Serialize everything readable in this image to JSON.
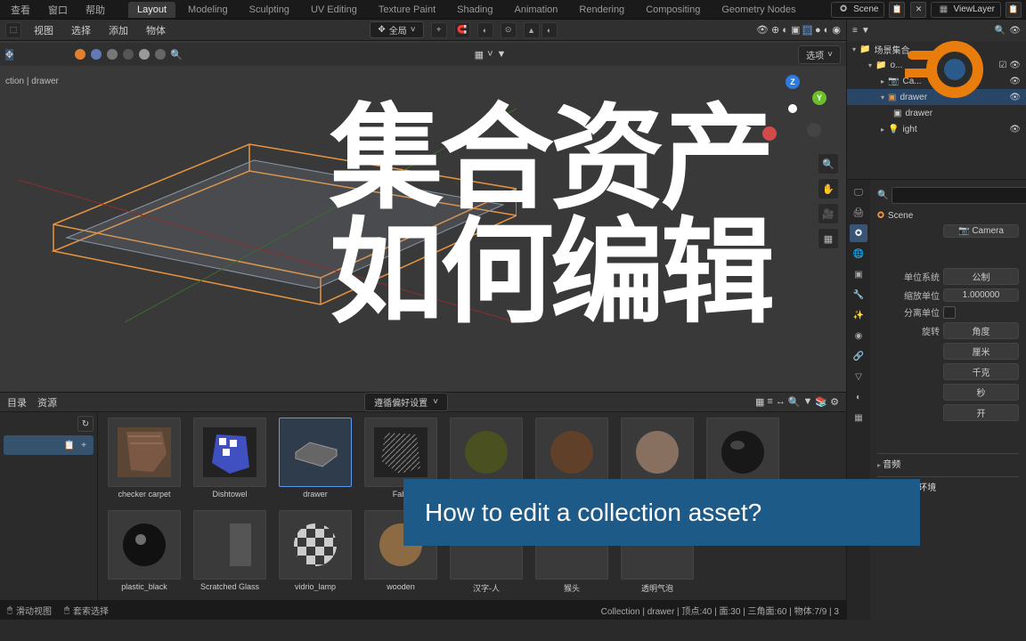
{
  "topmenu": {
    "cache": "查看",
    "window": "窗口",
    "help": "帮助"
  },
  "tabs": [
    "Layout",
    "Modeling",
    "Sculpting",
    "UV Editing",
    "Texture Paint",
    "Shading",
    "Animation",
    "Rendering",
    "Compositing",
    "Geometry Nodes"
  ],
  "scene": {
    "label": "Scene",
    "viewlayer": "ViewLayer"
  },
  "viewport_header": {
    "view": "视图",
    "select": "选择",
    "add": "添加",
    "object": "物体",
    "global": "全局",
    "options": "选项"
  },
  "breadcrumb": "ction | drawer",
  "outliner": {
    "root": "场景集合",
    "items": [
      {
        "name": "o...",
        "icon": "collection",
        "restrict": [
          "✓",
          "👁"
        ]
      },
      {
        "name": "Ca...",
        "icon": "camera",
        "restrict": [
          "👁"
        ]
      },
      {
        "name": "drawer",
        "icon": "collection",
        "restrict": [
          "👁"
        ],
        "selected": true
      },
      {
        "name": "drawer",
        "icon": "mesh",
        "restrict": []
      },
      {
        "name": "ight",
        "icon": "light",
        "restrict": [
          "👁"
        ]
      }
    ]
  },
  "properties": {
    "scene": "Scene",
    "camera_label": "",
    "camera": "Camera",
    "unit_system": "单位系统",
    "unit_system_val": "公制",
    "unit_scale": "缩放单位",
    "unit_scale_val": "1.000000",
    "separate": "分离单位",
    "rotation": "旋转",
    "rotation_val": "角度",
    "length": "厘米",
    "mass": "千克",
    "time": "秒",
    "on": "开",
    "sections": [
      "音频",
      "刚体世界环境"
    ]
  },
  "asset_browser": {
    "header": {
      "catalog": "目录",
      "asset": "资源",
      "preset": "遵循偏好设置"
    },
    "items_row1": [
      "checker carpet",
      "Dishtowel",
      "drawer",
      "Fabr"
    ],
    "items_row2": [
      "plastic_black",
      "Scratched Glass",
      "vidrio_lamp",
      "wooden",
      "汉字-人",
      "猴头",
      "透明气泡"
    ]
  },
  "footer": {
    "slide": "滑动视图",
    "lasso": "套索选择",
    "stats": "Collection | drawer | 顶点:40 | 面:30 | 三角面:60 | 物体:7/9 | 3"
  },
  "overlay": {
    "line1": "集合资产",
    "line2": "如何编辑",
    "caption": "How to edit a collection asset?"
  }
}
